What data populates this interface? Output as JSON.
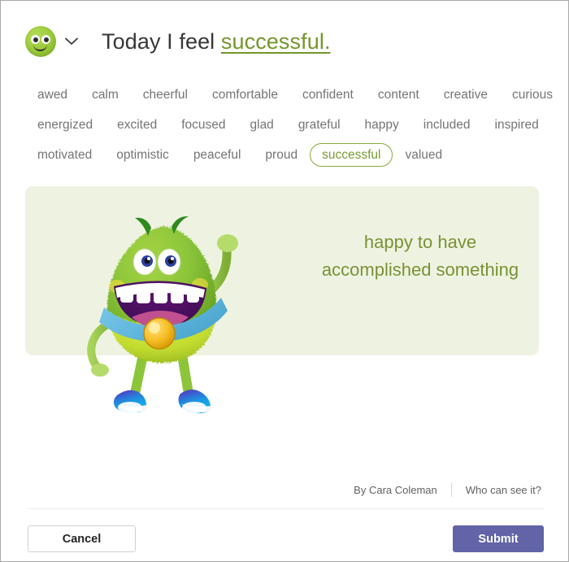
{
  "header": {
    "emoji_icon": "green-smiley-face-icon",
    "dropdown_icon": "chevron-down-icon",
    "title_prefix": "Today I feel ",
    "selected_mood_link": "successful."
  },
  "moods": {
    "rows": [
      [
        "awed",
        "calm",
        "cheerful",
        "comfortable",
        "confident",
        "content",
        "creative",
        "curious"
      ],
      [
        "energized",
        "excited",
        "focused",
        "glad",
        "grateful",
        "happy",
        "included",
        "inspired"
      ],
      [
        "motivated",
        "optimistic",
        "peaceful",
        "proud",
        "successful",
        "valued"
      ]
    ],
    "selected": "successful"
  },
  "card": {
    "caption_line1": "happy to have",
    "caption_line2": "accomplished something",
    "illustration": "green-furry-monster-cheering",
    "background_color": "#eef3e1",
    "text_color": "#789234"
  },
  "attribution": {
    "author": "By Cara Coleman",
    "privacy_link": "Who can see it?"
  },
  "actions": {
    "cancel_label": "Cancel",
    "submit_label": "Submit",
    "submit_color": "#6264a7"
  }
}
